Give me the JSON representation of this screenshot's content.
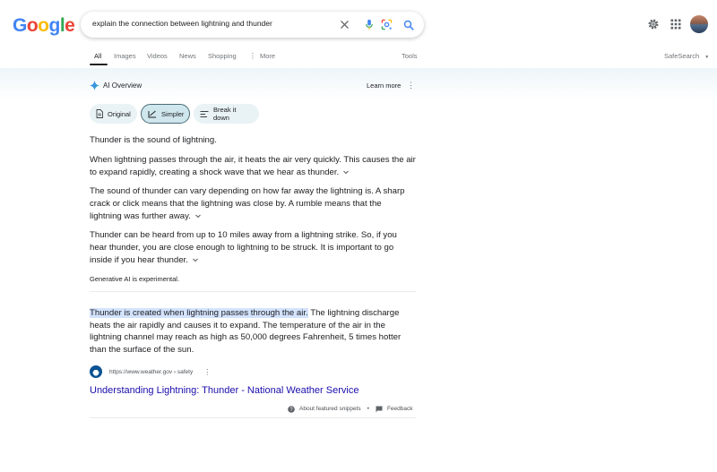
{
  "header": {
    "logo": "Google",
    "search_query": "explain the connection between lightning and thunder",
    "icons": [
      "clear-icon",
      "microphone-icon",
      "lens-icon",
      "search-icon",
      "settings-icon",
      "apps-icon",
      "avatar"
    ]
  },
  "tabs": {
    "items": [
      {
        "label": "All",
        "active": true
      },
      {
        "label": "Images"
      },
      {
        "label": "Videos"
      },
      {
        "label": "News"
      },
      {
        "label": "Shopping"
      },
      {
        "label": "More"
      }
    ],
    "tools": "Tools",
    "safesearch": "SafeSearch"
  },
  "ai_overview": {
    "title": "AI Overview",
    "learn_more": "Learn more",
    "chips": [
      {
        "label": "Original"
      },
      {
        "label": "Simpler",
        "selected": true
      },
      {
        "label": "Break it down"
      }
    ],
    "paragraphs": [
      "Thunder is the sound of lightning.",
      "When lightning passes through the air, it heats the air very quickly. This causes the air to expand rapidly, creating a shock wave that we hear as thunder.",
      "The sound of thunder can vary depending on how far away the lightning is. A sharp crack or click means that the lightning was close by. A rumble means that the lightning was further away.",
      "Thunder can be heard from up to 10 miles away from a lightning strike. So, if you hear thunder, you are close enough to lightning to be struck. It is important to go inside if you hear thunder."
    ],
    "generative_note": "Generative AI is experimental."
  },
  "featured_snippet": {
    "highlight": "Thunder is created when lightning passes through the air.",
    "text": " The lightning discharge heats the air rapidly and causes it to expand. The temperature of the air in the lightning channel may reach as high as 50,000 degrees Fahrenheit, 5 times hotter than the surface of the sun.",
    "cite": "https://www.weather.gov › safety",
    "link_title": "Understanding Lightning: Thunder - National Weather Service",
    "about": "About featured snippets",
    "separator": "•",
    "feedback": "Feedback"
  },
  "colors": {
    "link": "#1a0dab",
    "highlight": "#d3e3fd",
    "chip_bg": "#e9f3f6",
    "chip_selected_bg": "#cfe6ed"
  }
}
